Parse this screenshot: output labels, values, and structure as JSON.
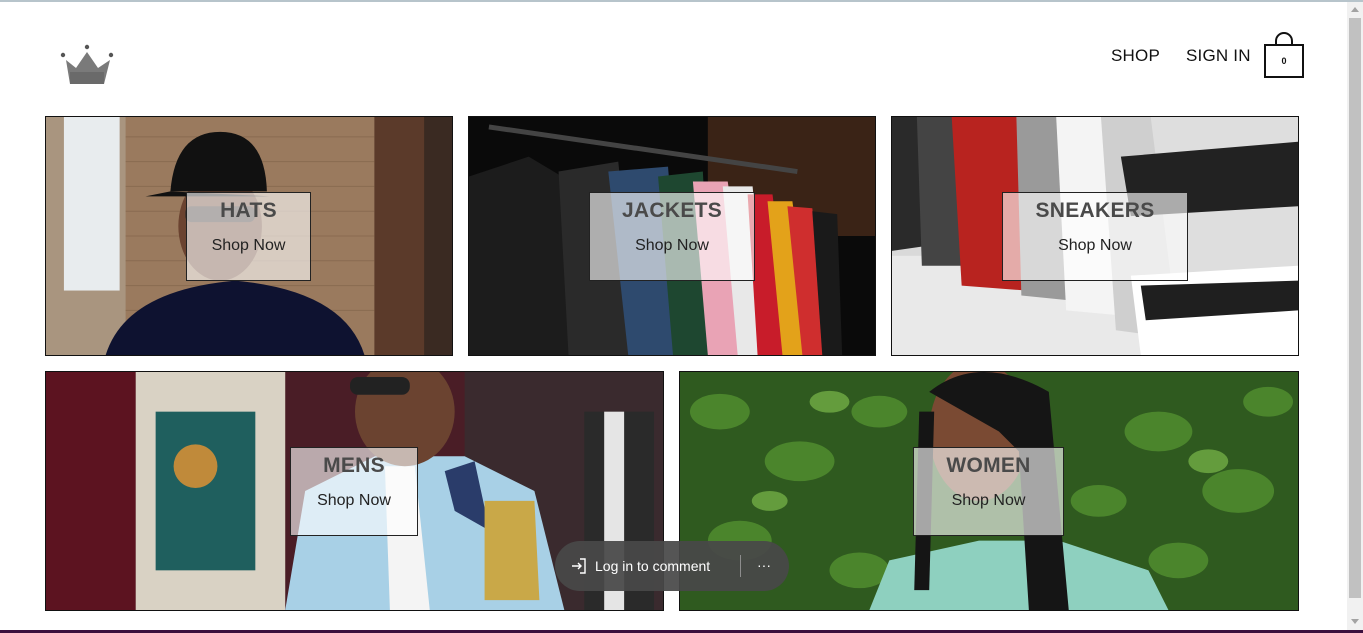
{
  "header": {
    "logo_icon": "crown-icon",
    "nav": {
      "shop": "SHOP",
      "sign_in": "SIGN IN"
    },
    "cart": {
      "icon": "shopping-bag-icon",
      "count": "0"
    }
  },
  "categories": [
    {
      "title": "HATS",
      "cta": "Shop Now"
    },
    {
      "title": "JACKETS",
      "cta": "Shop Now"
    },
    {
      "title": "SNEAKERS",
      "cta": "Shop Now"
    },
    {
      "title": "MENS",
      "cta": "Shop Now"
    },
    {
      "title": "WOMEN",
      "cta": "Shop Now"
    }
  ],
  "comment_bar": {
    "login_label": "Log in to comment",
    "login_icon": "sign-in-icon",
    "more_icon": "more-options-icon",
    "more_label": "···"
  }
}
